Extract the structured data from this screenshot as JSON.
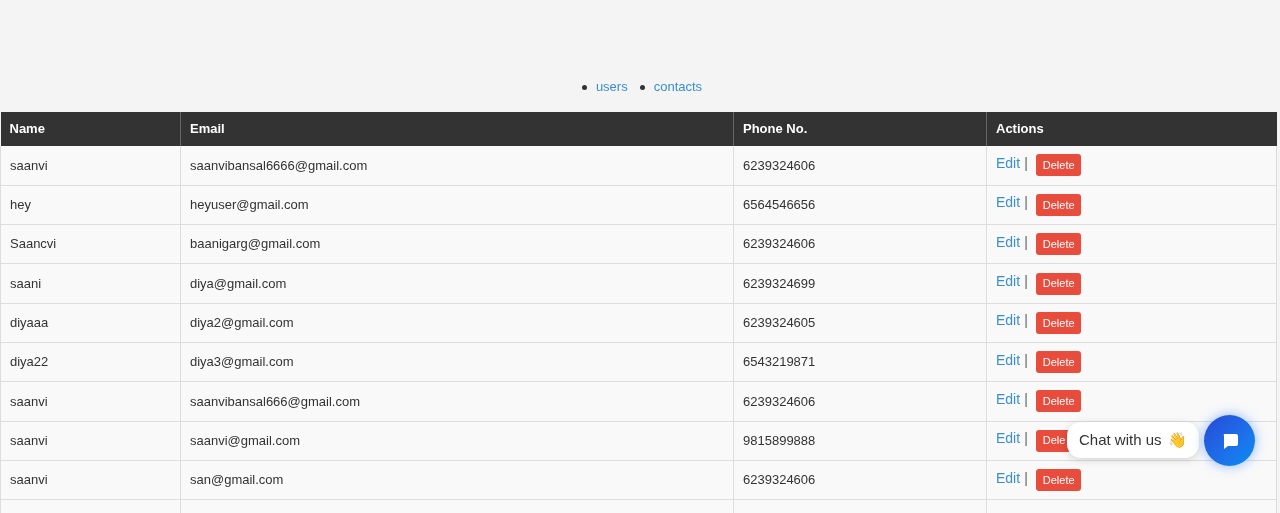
{
  "nav": [
    {
      "label": "users"
    },
    {
      "label": "contacts"
    }
  ],
  "table": {
    "columns": [
      "Name",
      "Email",
      "Phone No.",
      "Actions"
    ],
    "rows": [
      {
        "name": "saanvi",
        "email": "saanvibansal6666@gmail.com",
        "phone": "6239324606",
        "edit": "Edit",
        "separator": "|",
        "delete": "Delete"
      },
      {
        "name": "hey",
        "email": "heyuser@gmail.com",
        "phone": "6564546656",
        "edit": "Edit",
        "separator": "|",
        "delete": "Delete"
      },
      {
        "name": "Saancvi",
        "email": "baanigarg@gmail.com",
        "phone": "6239324606",
        "edit": "Edit",
        "separator": "|",
        "delete": "Delete"
      },
      {
        "name": "saani",
        "email": "diya@gmail.com",
        "phone": "6239324699",
        "edit": "Edit",
        "separator": "|",
        "delete": "Delete"
      },
      {
        "name": "diyaaa",
        "email": "diya2@gmail.com",
        "phone": "6239324605",
        "edit": "Edit",
        "separator": "|",
        "delete": "Delete"
      },
      {
        "name": "diya22",
        "email": "diya3@gmail.com",
        "phone": "6543219871",
        "edit": "Edit",
        "separator": "|",
        "delete": "Delete"
      },
      {
        "name": "saanvi",
        "email": "saanvibansal666@gmail.com",
        "phone": "6239324606",
        "edit": "Edit",
        "separator": "|",
        "delete": "Delete"
      },
      {
        "name": "saanvi",
        "email": "saanvi@gmail.com",
        "phone": "9815899888",
        "edit": "Edit",
        "separator": "|",
        "delete": "Dele"
      },
      {
        "name": "saanvi",
        "email": "san@gmail.com",
        "phone": "6239324606",
        "edit": "Edit",
        "separator": "|",
        "delete": "Delete"
      }
    ]
  },
  "chat": {
    "label": "Chat with us",
    "emoji": "👋"
  }
}
